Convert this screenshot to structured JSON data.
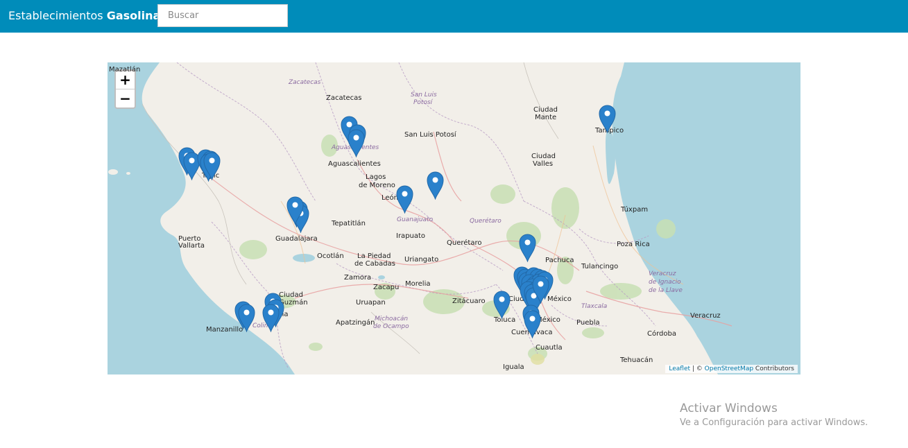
{
  "navbar": {
    "brand_text": "Establecimientos ",
    "brand_bold": "Gasolina",
    "search_placeholder": "Buscar",
    "color": "#008cba"
  },
  "map": {
    "zoom_in": "+",
    "zoom_out": "−",
    "attribution_leaflet": "Leaflet",
    "attribution_sep": " | © ",
    "attribution_osm": "OpenStreetMap",
    "attribution_contrib": " Contributors",
    "marker_color": "#2a81cb",
    "labels": [
      {
        "text": "Mazatlán",
        "kind": "city"
      },
      {
        "text": "Zacatecas",
        "kind": "state"
      },
      {
        "text": "Zacatecas",
        "kind": "city"
      },
      {
        "text": "San Luis",
        "kind": "state"
      },
      {
        "text": "Potosí",
        "kind": "state"
      },
      {
        "text": "San Luis Potosí",
        "kind": "city"
      },
      {
        "text": "Ciudad",
        "kind": "city"
      },
      {
        "text": "Mante",
        "kind": "city"
      },
      {
        "text": "Tampico",
        "kind": "city"
      },
      {
        "text": "Aguascalientes",
        "kind": "state"
      },
      {
        "text": "Aguascalientes",
        "kind": "city"
      },
      {
        "text": "Ciudad",
        "kind": "city"
      },
      {
        "text": "Valles",
        "kind": "city"
      },
      {
        "text": "Tepic",
        "kind": "city"
      },
      {
        "text": "Lagos",
        "kind": "city"
      },
      {
        "text": "de Moreno",
        "kind": "city"
      },
      {
        "text": "León",
        "kind": "city"
      },
      {
        "text": "Guanajuato",
        "kind": "state"
      },
      {
        "text": "Querétaro",
        "kind": "state"
      },
      {
        "text": "Túxpam",
        "kind": "city"
      },
      {
        "text": "Tepatitlán",
        "kind": "city"
      },
      {
        "text": "Puerto",
        "kind": "city"
      },
      {
        "text": "Vallarta",
        "kind": "city"
      },
      {
        "text": "Guadalajara",
        "kind": "city"
      },
      {
        "text": "Irapuato",
        "kind": "city"
      },
      {
        "text": "Querétaro",
        "kind": "city"
      },
      {
        "text": "Pachuca",
        "kind": "city"
      },
      {
        "text": "Poza Rica",
        "kind": "city"
      },
      {
        "text": "Ocotlán",
        "kind": "city"
      },
      {
        "text": "La Piedad",
        "kind": "city"
      },
      {
        "text": "de Cabadas",
        "kind": "city"
      },
      {
        "text": "Uriangato",
        "kind": "city"
      },
      {
        "text": "Tulancingo",
        "kind": "city"
      },
      {
        "text": "Veracruz",
        "kind": "state"
      },
      {
        "text": "de Ignacio",
        "kind": "state"
      },
      {
        "text": "de la Llave",
        "kind": "state"
      },
      {
        "text": "Zamora",
        "kind": "city"
      },
      {
        "text": "Zacapu",
        "kind": "city"
      },
      {
        "text": "Morelia",
        "kind": "city"
      },
      {
        "text": "Ciudad",
        "kind": "city"
      },
      {
        "text": "Guzmán",
        "kind": "city"
      },
      {
        "text": "Zitácuaro",
        "kind": "city"
      },
      {
        "text": "Ciudad",
        "kind": "city"
      },
      {
        "text": "México",
        "kind": "city"
      },
      {
        "text": "Tlaxcala",
        "kind": "state"
      },
      {
        "text": "Uruapan",
        "kind": "city"
      },
      {
        "text": "Colima",
        "kind": "state"
      },
      {
        "text": "Colima",
        "kind": "city"
      },
      {
        "text": "Michoacán",
        "kind": "state"
      },
      {
        "text": "de Ocampo",
        "kind": "state"
      },
      {
        "text": "Apatzingán",
        "kind": "city"
      },
      {
        "text": "Toluca",
        "kind": "city"
      },
      {
        "text": "México",
        "kind": "city"
      },
      {
        "text": "Puebla",
        "kind": "city"
      },
      {
        "text": "Veracruz",
        "kind": "city"
      },
      {
        "text": "Manzanillo",
        "kind": "city"
      },
      {
        "text": "Cuernavaca",
        "kind": "city"
      },
      {
        "text": "Córdoba",
        "kind": "city"
      },
      {
        "text": "Cuautla",
        "kind": "city"
      },
      {
        "text": "Tehuacán",
        "kind": "city"
      },
      {
        "text": "Iguala",
        "kind": "city"
      }
    ],
    "marker_count": 42
  },
  "watermark": {
    "title": "Activar Windows",
    "subtitle": "Ve a Configuración para activar Windows."
  }
}
